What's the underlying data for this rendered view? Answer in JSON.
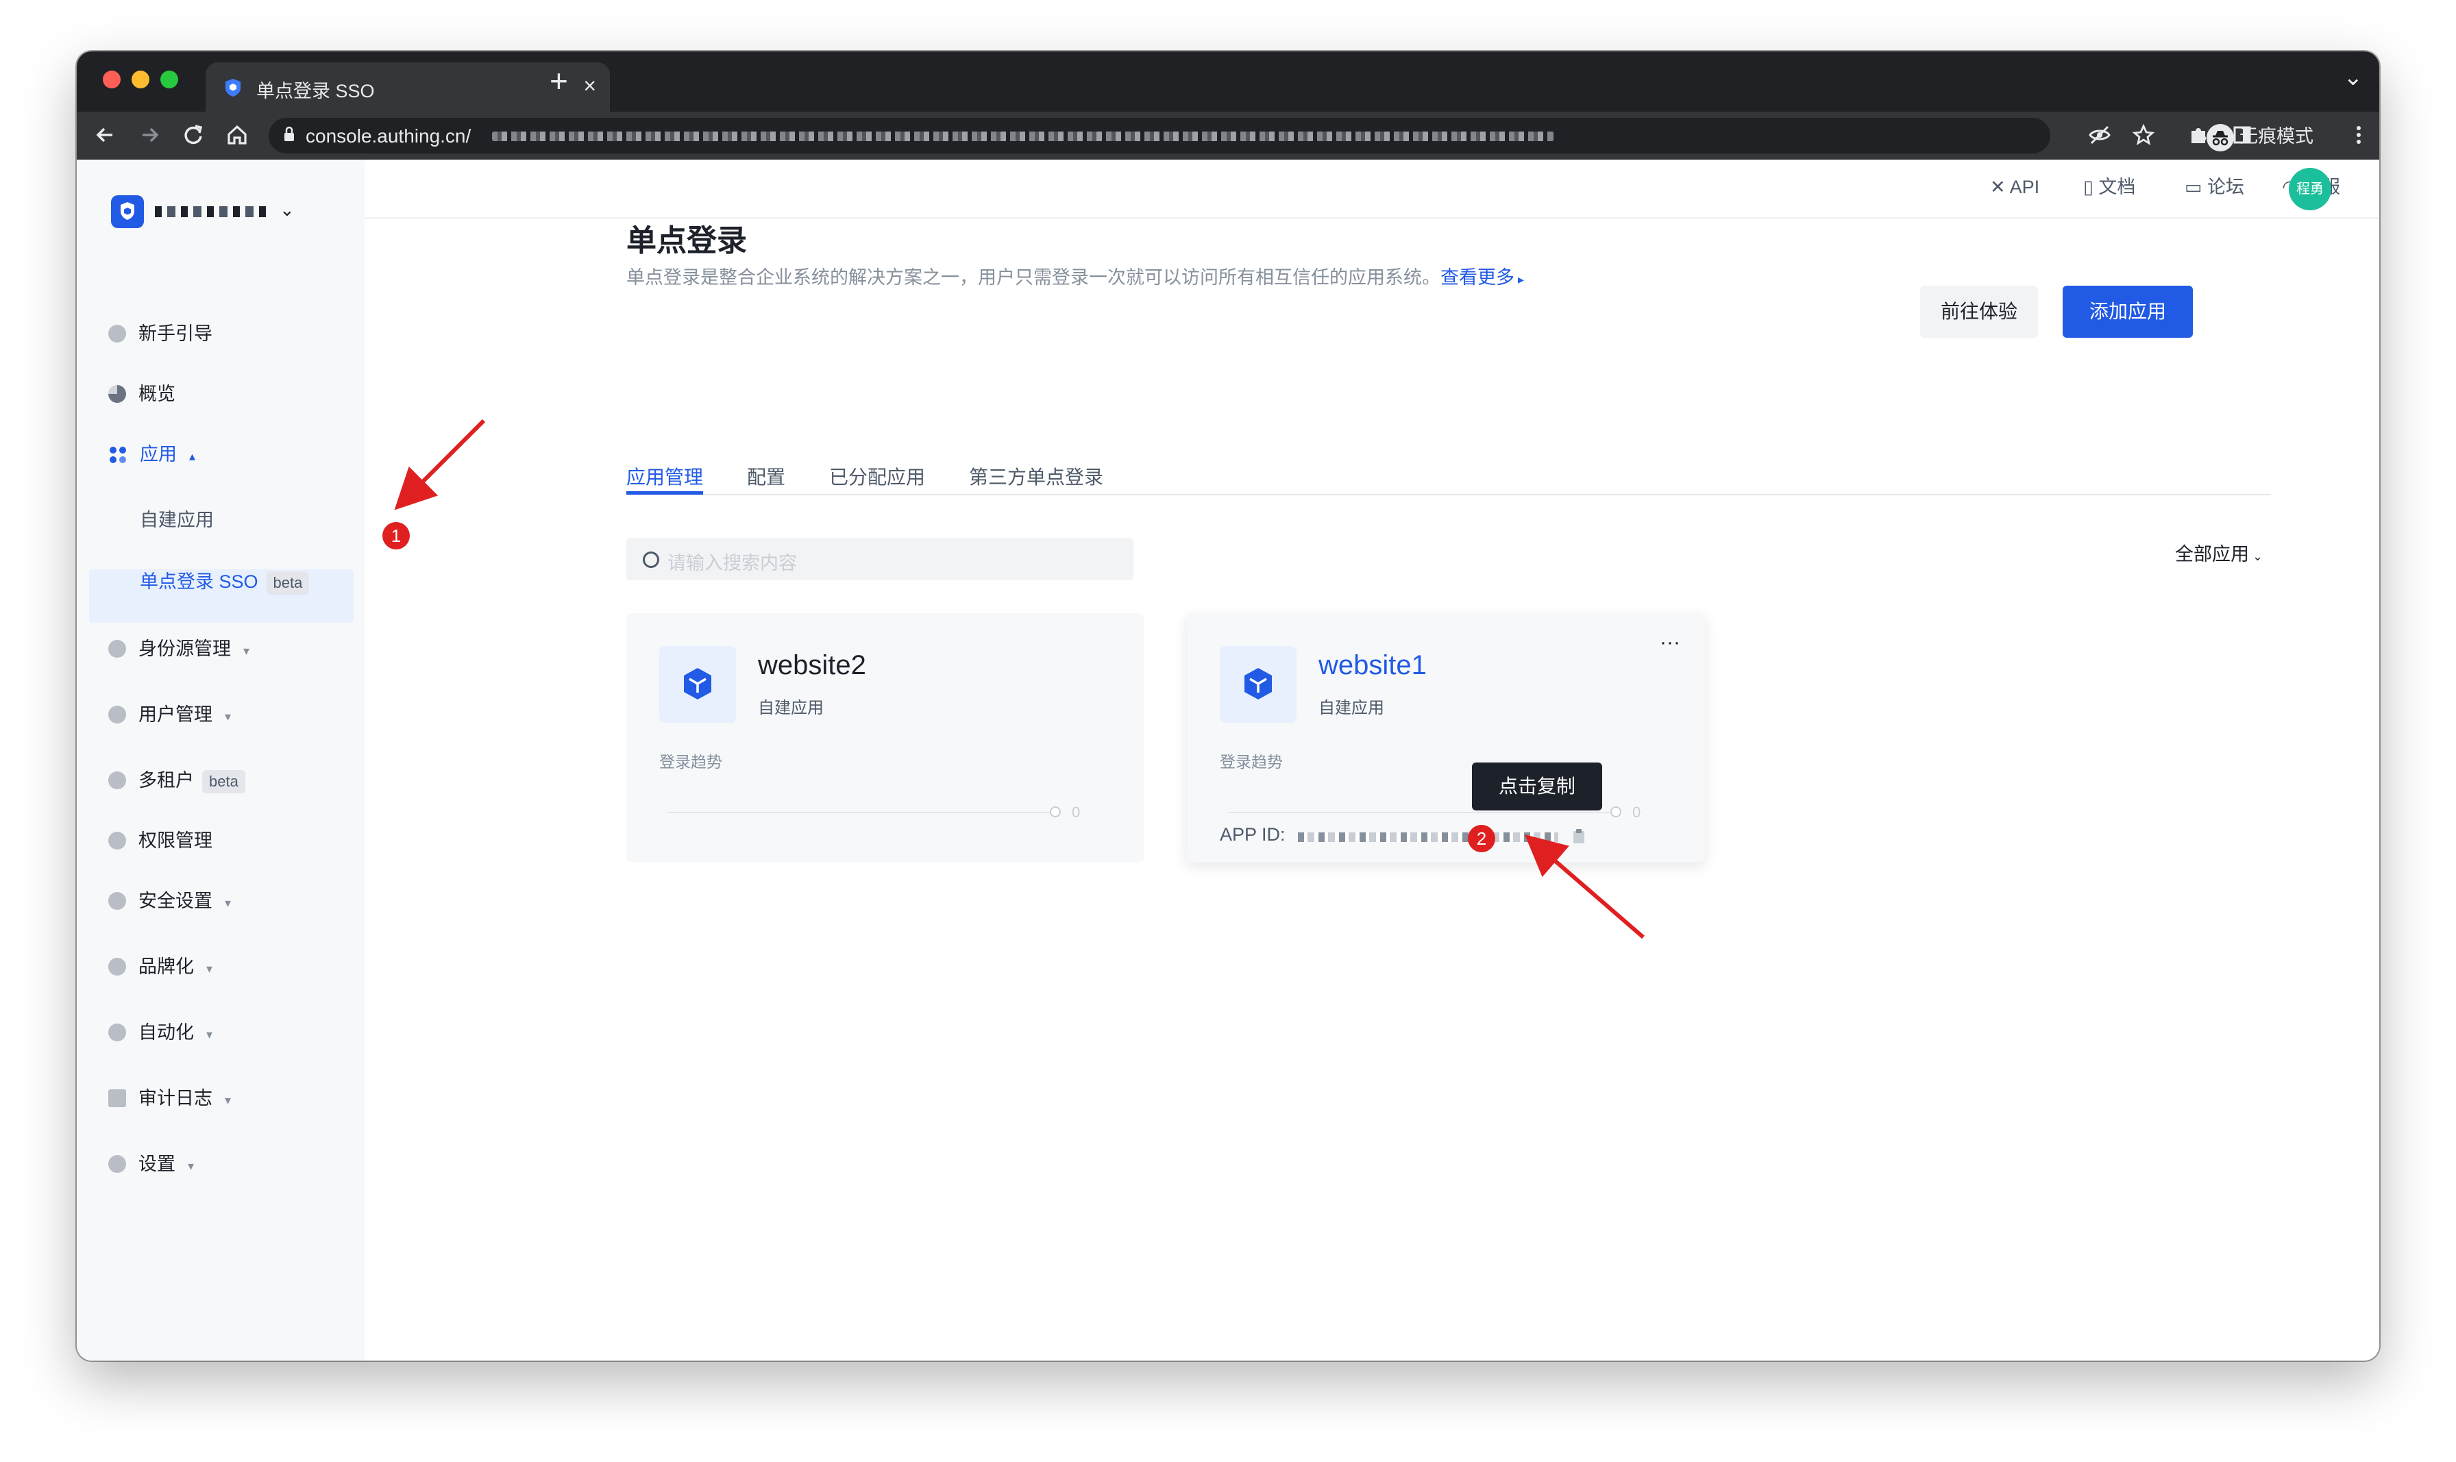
{
  "browser": {
    "tab_title": "单点登录 SSO",
    "tab_close": "×",
    "new_tab": "+",
    "tab_dropdown": "⌄",
    "url": "console.authing.cn/",
    "incognito_label": "无痕模式",
    "colors": {
      "chrome_dark": "#202124",
      "chrome_tab": "#35363a",
      "close": "#ff5f57",
      "minimize": "#febc2e",
      "maximize": "#28c840"
    }
  },
  "sidebar": {
    "org_caret": "⌄",
    "items": [
      {
        "label": "新手引导",
        "icon": "compass-icon"
      },
      {
        "label": "概览",
        "icon": "pie-chart-icon"
      },
      {
        "label": "应用",
        "icon": "apps-icon",
        "caret": "▴",
        "expanded": true
      },
      {
        "label": "身份源管理",
        "icon": "share-icon",
        "caret": "▾"
      },
      {
        "label": "用户管理",
        "icon": "users-icon",
        "caret": "▾"
      },
      {
        "label": "多租户",
        "icon": "globe-icon",
        "badge": "beta"
      },
      {
        "label": "权限管理",
        "icon": "lock-icon"
      },
      {
        "label": "安全设置",
        "icon": "shield-icon",
        "caret": "▾"
      },
      {
        "label": "品牌化",
        "icon": "brush-icon",
        "caret": "▾"
      },
      {
        "label": "自动化",
        "icon": "robot-icon",
        "caret": "▾"
      },
      {
        "label": "审计日志",
        "icon": "log-icon",
        "caret": "▾"
      },
      {
        "label": "设置",
        "icon": "gear-icon",
        "caret": "▾"
      }
    ],
    "sub_items": [
      {
        "label": "自建应用"
      },
      {
        "label": "单点登录 SSO",
        "badge": "beta",
        "active": true
      }
    ],
    "accent": "#215ae5"
  },
  "topnav": {
    "items": [
      {
        "label": "API",
        "icon": "tools-icon"
      },
      {
        "label": "文档",
        "icon": "book-icon"
      },
      {
        "label": "论坛",
        "icon": "comment-icon"
      },
      {
        "label": "客服",
        "icon": "headset-icon"
      }
    ],
    "avatar_text": "程勇"
  },
  "page": {
    "title": "单点登录",
    "description": "单点登录是整合企业系统的解决方案之一，用户只需登录一次就可以访问所有相互信任的应用系统。",
    "more_link": "查看更多",
    "try_button": "前往体验",
    "add_button": "添加应用",
    "tabs": [
      "应用管理",
      "配置",
      "已分配应用",
      "第三方单点登录"
    ],
    "search_placeholder": "请输入搜索内容",
    "filter_label": "全部应用"
  },
  "cards": [
    {
      "name": "website2",
      "type": "自建应用",
      "trend_label": "登录趋势",
      "trend_value": "0"
    },
    {
      "name": "website1",
      "type": "自建应用",
      "trend_label": "登录趋势",
      "trend_value": "0",
      "more": "···",
      "app_id_label": "APP ID:",
      "tooltip": "点击复制"
    }
  ],
  "annotations": {
    "marker1": "1",
    "marker2": "2",
    "color": "#e02020"
  }
}
